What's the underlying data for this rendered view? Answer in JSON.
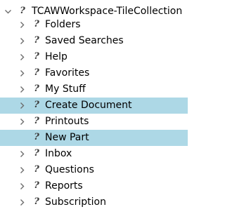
{
  "tree": {
    "root": {
      "label": "TCAWWorkspace-TileCollection",
      "expanded": true,
      "icon": "question-mark-icon"
    },
    "children": [
      {
        "label": "Folders",
        "has_children": true,
        "selected": false
      },
      {
        "label": "Saved Searches",
        "has_children": true,
        "selected": false
      },
      {
        "label": "Help",
        "has_children": true,
        "selected": false
      },
      {
        "label": "Favorites",
        "has_children": true,
        "selected": false
      },
      {
        "label": "My Stuff",
        "has_children": true,
        "selected": false
      },
      {
        "label": "Create Document",
        "has_children": true,
        "selected": true
      },
      {
        "label": "Printouts",
        "has_children": true,
        "selected": false
      },
      {
        "label": "New Part",
        "has_children": false,
        "selected": true
      },
      {
        "label": "Inbox",
        "has_children": true,
        "selected": false
      },
      {
        "label": "Questions",
        "has_children": true,
        "selected": false
      },
      {
        "label": "Reports",
        "has_children": true,
        "selected": false
      },
      {
        "label": "Subscription",
        "has_children": true,
        "selected": false
      }
    ],
    "colors": {
      "selection": "#add8e6",
      "chevron": "#6e6e6e",
      "icon": "#3c3c3c",
      "text": "#000000"
    }
  }
}
